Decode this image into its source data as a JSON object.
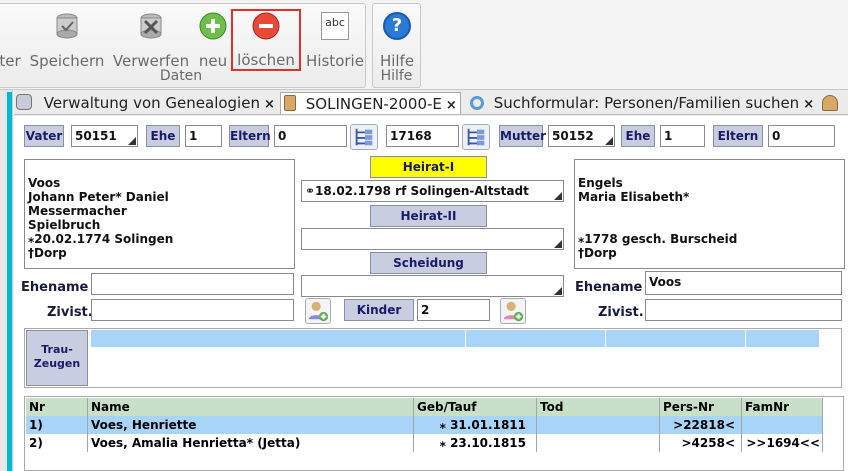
{
  "ribbon": {
    "buttons": [
      {
        "label": "ter",
        "icon": "truncated-icon"
      },
      {
        "label": "Speichern",
        "icon": "save-icon"
      },
      {
        "label": "Verwerfen",
        "icon": "discard-icon"
      },
      {
        "label": "neu",
        "icon": "add-icon"
      },
      {
        "label": "löschen",
        "icon": "delete-icon"
      },
      {
        "label": "Historie",
        "icon": "history-icon"
      },
      {
        "label": "Hilfe",
        "icon": "help-icon"
      }
    ],
    "group_daten": "Daten",
    "group_hilfe": "Hilfe",
    "history_icon_text": "abc",
    "help_icon_text": "?"
  },
  "tabs": [
    {
      "label": "Verwaltung von Genealogien",
      "close": "×"
    },
    {
      "label": "SOLINGEN-2000-E",
      "close": "×"
    },
    {
      "label": "Suchformular: Personen/Familien suchen",
      "close": "×"
    }
  ],
  "header": {
    "vater_label": "Vater",
    "vater_id": "50151",
    "ehe_label": "Ehe",
    "vater_ehe": "1",
    "eltern_label": "Eltern",
    "vater_eltern": "0",
    "family_id": "17168",
    "mutter_label": "Mutter",
    "mutter_id": "50152",
    "mutter_ehe": "1",
    "mutter_eltern": "0"
  },
  "husband": {
    "lines": [
      "Voos",
      "Johann Peter* Daniel",
      "Messermacher",
      "Spielbruch",
      "⁎20.02.1774 Solingen",
      "†Dorp"
    ],
    "ehename": "",
    "zivist": ""
  },
  "wife": {
    "lines": [
      "Engels",
      "Maria Elisabeth*",
      "",
      "",
      "⁎1778 gesch. Burscheid",
      "†Dorp"
    ],
    "ehename": "Voos",
    "zivist": ""
  },
  "marriage": {
    "heirat1_label": "Heirat-I",
    "heirat1_value": "⚭18.02.1798 rf Solingen-Altstadt",
    "heirat2_label": "Heirat-II",
    "heirat2_value": "",
    "scheidung_label": "Scheidung",
    "scheidung_value": "",
    "kinder_label": "Kinder",
    "kinder_value": "2"
  },
  "labels": {
    "ehename": "Ehename",
    "zivist": "Zivist.",
    "trauzeugen": "Trau-\nZeugen"
  },
  "children": {
    "columns": [
      "Nr",
      "Name",
      "Geb/Tauf",
      "Tod",
      "Pers-Nr",
      "FamNr"
    ],
    "rows": [
      {
        "nr": "1)",
        "name": "Voes, Henriette",
        "geb": "⁎ 31.01.1811",
        "tod": "",
        "pers": ">22818<",
        "fam": ""
      },
      {
        "nr": "2)",
        "name": "Voes, Amalia Henrietta* (Jetta)",
        "geb": "⁎ 23.10.1815",
        "tod": "",
        "pers": ">4258<",
        "fam": ">>1694<<"
      }
    ]
  },
  "colors": {
    "accent": "#00b8d8",
    "delete_border": "#e03030",
    "heirat_highlight": "#ffff00",
    "row_selected": "#a8d4f8",
    "grid_header": "#c8e0c8"
  }
}
